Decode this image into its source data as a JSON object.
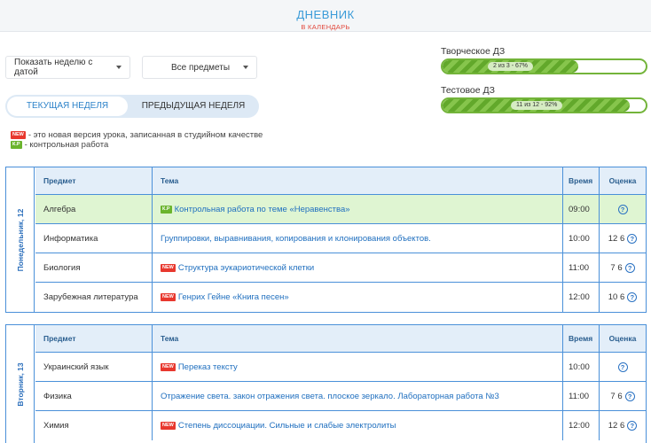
{
  "header": {
    "title": "ДНЕВНИК",
    "calendar_link": "В КАЛЕНДАРЬ"
  },
  "filters": {
    "week_select": "Показать неделю с датой",
    "subject_select": "Все предметы"
  },
  "tabs": {
    "current": "ТЕКУЩАЯ НЕДЕЛЯ",
    "previous": "ПРЕДЫДУЩАЯ НЕДЕЛЯ"
  },
  "legend": {
    "new_badge": "NEW",
    "new_text": "- это новая версия урока, записанная в студийном качестве",
    "kr_badge": "К.Р",
    "kr_text": "- контрольная работа"
  },
  "progress": [
    {
      "label": "Творческое ДЗ",
      "text": "2 из 3 - 67%",
      "fraction": 0.67
    },
    {
      "label": "Тестовое ДЗ",
      "text": "11 из 12 - 92%",
      "fraction": 0.92
    }
  ],
  "table_headers": {
    "subject": "Предмет",
    "topic": "Тема",
    "time": "Время",
    "grade": "Оценка"
  },
  "days": [
    {
      "label": "Понедельник, 12",
      "lessons": [
        {
          "subject": "Алгебра",
          "badge": "К.Р",
          "topic": "Контрольная работа по теме «Неравенства»",
          "time": "09:00",
          "grade": ""
        },
        {
          "subject": "Информатика",
          "badge": "",
          "topic": "Группировки, выравнивания, копирования и клонирования объектов.",
          "time": "10:00",
          "grade": "12 6"
        },
        {
          "subject": "Биология",
          "badge": "NEW",
          "topic": "Структура эукариотической клетки",
          "time": "11:00",
          "grade": "7 6"
        },
        {
          "subject": "Зарубежная литература",
          "badge": "NEW",
          "topic": "Генрих Гейне «Книга песен»",
          "time": "12:00",
          "grade": "10 6"
        }
      ]
    },
    {
      "label": "Вторник, 13",
      "lessons": [
        {
          "subject": "Украинский язык",
          "badge": "NEW",
          "topic": "Переказ тексту",
          "time": "10:00",
          "grade": ""
        },
        {
          "subject": "Физика",
          "badge": "",
          "topic": "Отражение света. закон отражения света. плоское зеркало. Лабораторная работа №3",
          "time": "11:00",
          "grade": "7 6"
        },
        {
          "subject": "Химия",
          "badge": "NEW",
          "topic": "Степень диссоциации. Сильные и слабые электролиты",
          "time": "12:00",
          "grade": "12 6"
        }
      ]
    }
  ],
  "icons": {
    "grade_help": "question-circle-icon",
    "dropdown": "chevron-down-icon"
  },
  "colors": {
    "accent": "#3a9bd8",
    "link": "#1f6fbf",
    "new": "#e8382e",
    "kr": "#6ab42d",
    "progress": "#73b43a",
    "highlight_row": "#dff5d2"
  }
}
